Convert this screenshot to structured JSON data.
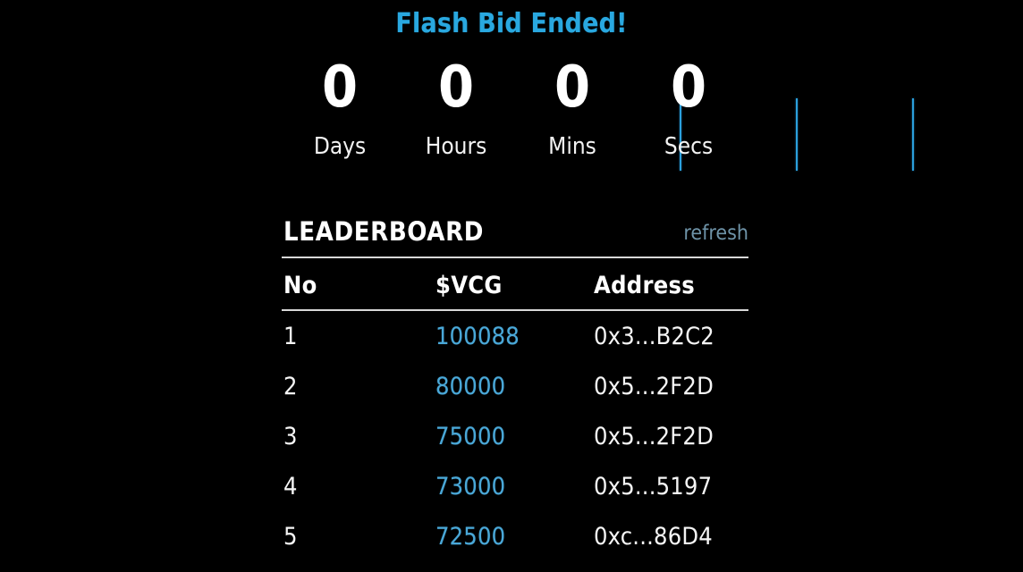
{
  "title": "Flash Bid Ended!",
  "colors": {
    "background": "#000000",
    "accent_blue": "#29a8e0",
    "value_blue": "#4aa8d8",
    "refresh_blue": "#6e93a8",
    "text_white": "#ffffff",
    "rule": "#d8d8d8"
  },
  "countdown": {
    "units": [
      {
        "value": "0",
        "label": "Days"
      },
      {
        "value": "0",
        "label": "Hours"
      },
      {
        "value": "0",
        "label": "Mins"
      },
      {
        "value": "0",
        "label": "Secs"
      }
    ]
  },
  "leaderboard": {
    "title": "LEADERBOARD",
    "refresh_label": "refresh",
    "columns": {
      "no": "No",
      "vcg": "$VCG",
      "address": "Address"
    },
    "rows": [
      {
        "no": "1",
        "vcg": "100088",
        "address": "0x3...B2C2"
      },
      {
        "no": "2",
        "vcg": "80000",
        "address": "0x5...2F2D"
      },
      {
        "no": "3",
        "vcg": "75000",
        "address": "0x5...2F2D"
      },
      {
        "no": "4",
        "vcg": "73000",
        "address": "0x5...5197"
      },
      {
        "no": "5",
        "vcg": "72500",
        "address": "0xc...86D4"
      }
    ]
  }
}
